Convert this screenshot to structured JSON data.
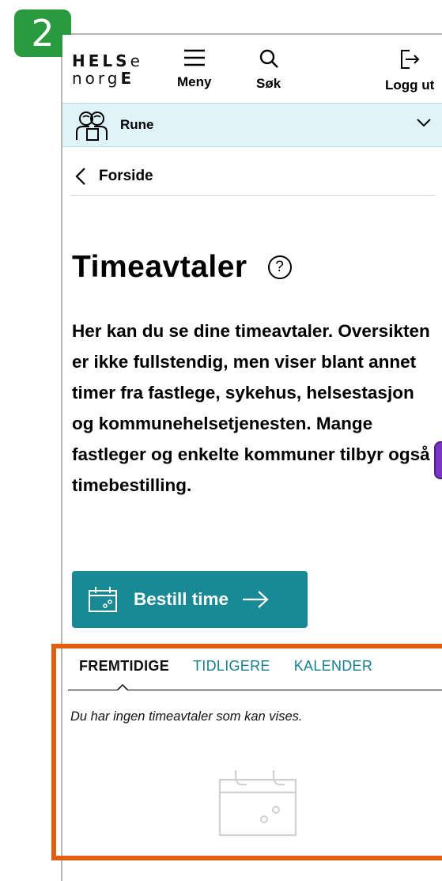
{
  "badge": {
    "step": "2"
  },
  "logo": {
    "row1": "HELS",
    "row1_tail": "e",
    "row2": "norg",
    "row2_tail": "E"
  },
  "nav": {
    "meny": "Meny",
    "sok": "Søk",
    "logg_ut": "Logg ut"
  },
  "user": {
    "name": "Rune"
  },
  "breadcrumb": {
    "back_label": "Forside"
  },
  "page": {
    "title": "Timeavtaler",
    "help": "?",
    "intro": "Her kan du se dine timeavtaler. Oversikten er ikke fullstendig, men viser blant annet timer fra fastlege, sykehus, helsestasjon og kommunehelsetjenesten. Mange fastleger og enkelte kommuner tilbyr også timebestilling."
  },
  "cta": {
    "label": "Bestill time"
  },
  "tabs": [
    {
      "label": "FREMTIDIGE",
      "active": true
    },
    {
      "label": "TIDLIGERE",
      "active": false
    },
    {
      "label": "KALENDER",
      "active": false
    }
  ],
  "empty": {
    "message": "Du har ingen timeavtaler som kan vises."
  },
  "colors": {
    "badge": "#2a9a3e",
    "primary": "#198996",
    "tab_link": "#167f8f",
    "userbar": "#def4f8",
    "highlight": "#e05e0c"
  }
}
